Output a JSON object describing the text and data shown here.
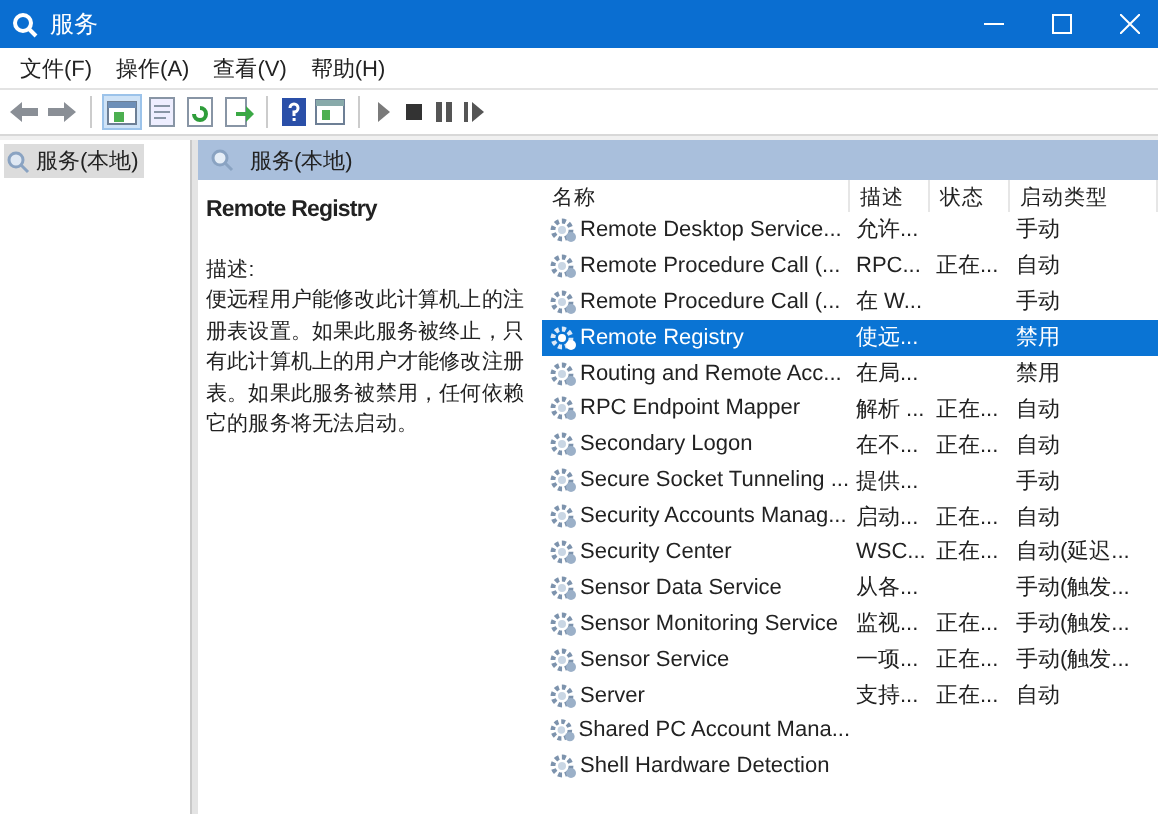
{
  "window": {
    "title": "服务"
  },
  "menu": [
    "文件(F)",
    "操作(A)",
    "查看(V)",
    "帮助(H)"
  ],
  "tree": [
    {
      "label": "服务(本地)",
      "selected": true
    }
  ],
  "panel_header": "服务(本地)",
  "details": {
    "title": "Remote Registry",
    "label": "描述:",
    "text": "便远程用户能修改此计算机上的注册表设置。如果此服务被终止，只有此计算机上的用户才能修改注册表。如果此服务被禁用，任何依赖它的服务将无法启动。"
  },
  "table": {
    "columns": [
      "名称",
      "描述",
      "状态",
      "启动类型"
    ],
    "rows": [
      {
        "name": "Remote Desktop Service...",
        "description": "允许...",
        "status": "",
        "startup": "手动",
        "selected": false
      },
      {
        "name": "Remote Procedure Call (...",
        "description": "RPC...",
        "status": "正在...",
        "startup": "自动",
        "selected": false
      },
      {
        "name": "Remote Procedure Call (...",
        "description": "在 W...",
        "status": "",
        "startup": "手动",
        "selected": false
      },
      {
        "name": "Remote Registry",
        "description": "使远...",
        "status": "",
        "startup": "禁用",
        "selected": true
      },
      {
        "name": "Routing and Remote Acc...",
        "description": "在局...",
        "status": "",
        "startup": "禁用",
        "selected": false
      },
      {
        "name": "RPC Endpoint Mapper",
        "description": "解析 ...",
        "status": "正在...",
        "startup": "自动",
        "selected": false
      },
      {
        "name": "Secondary Logon",
        "description": "在不...",
        "status": "正在...",
        "startup": "自动",
        "selected": false
      },
      {
        "name": "Secure Socket Tunneling ...",
        "description": "提供...",
        "status": "",
        "startup": "手动",
        "selected": false
      },
      {
        "name": "Security Accounts Manag...",
        "description": "启动...",
        "status": "正在...",
        "startup": "自动",
        "selected": false
      },
      {
        "name": "Security Center",
        "description": "WSC...",
        "status": "正在...",
        "startup": "自动(延迟...",
        "selected": false
      },
      {
        "name": "Sensor Data Service",
        "description": "从各...",
        "status": "",
        "startup": "手动(触发...",
        "selected": false
      },
      {
        "name": "Sensor Monitoring Service",
        "description": "监视...",
        "status": "正在...",
        "startup": "手动(触发...",
        "selected": false
      },
      {
        "name": "Sensor Service",
        "description": "一项...",
        "status": "正在...",
        "startup": "手动(触发...",
        "selected": false
      },
      {
        "name": "Server",
        "description": "支持...",
        "status": "正在...",
        "startup": "自动",
        "selected": false
      },
      {
        "name": "Shared PC Account Mana...",
        "description": "",
        "status": "",
        "startup": "",
        "selected": false
      },
      {
        "name": "Shell Hardware Detection",
        "description": "",
        "status": "",
        "startup": "",
        "selected": false
      }
    ]
  }
}
